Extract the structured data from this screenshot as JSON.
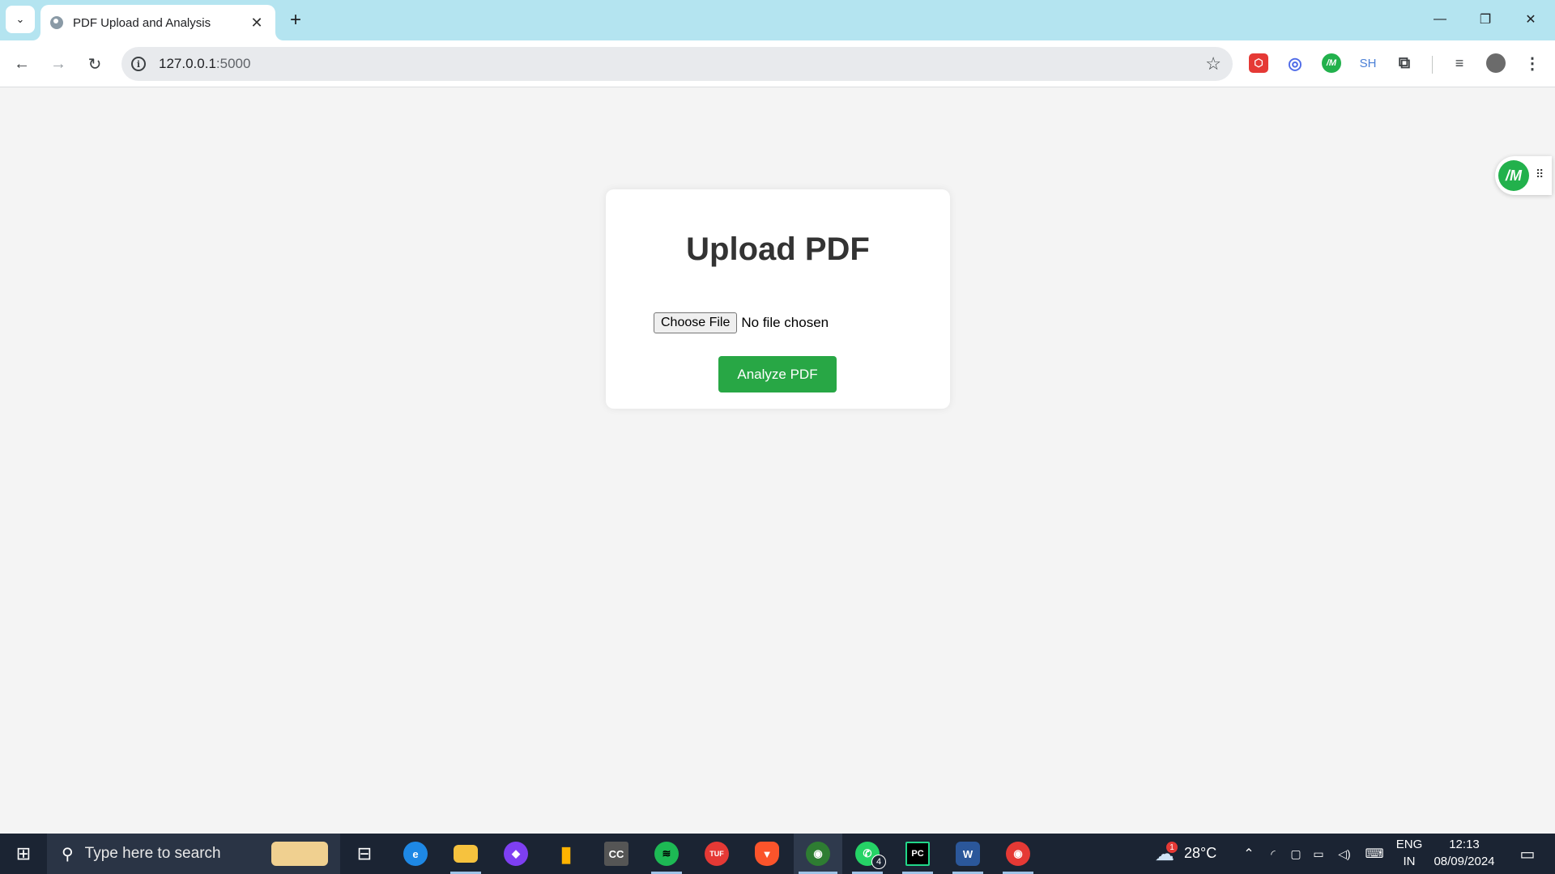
{
  "browser": {
    "tab_title": "PDF Upload and Analysis",
    "url_host": "127.0.0.1",
    "url_port": ":5000",
    "new_tab_symbol": "+",
    "extensions": [
      {
        "icon": "cube-extension-icon",
        "text": "⬡",
        "color": "#e53935"
      },
      {
        "icon": "ring-extension-icon",
        "text": "◎",
        "color": "#4f6be8"
      },
      {
        "icon": "im-extension-icon",
        "text": "/M",
        "color": "#22b14c"
      },
      {
        "icon": "sh-extension-icon",
        "text": "SH",
        "color": "#4a7fd6"
      }
    ]
  },
  "page": {
    "heading": "Upload PDF",
    "choose_file_label": "Choose File",
    "file_status": "No file chosen",
    "analyze_button_label": "Analyze PDF",
    "side_widget_logo": "/M"
  },
  "taskbar": {
    "search_placeholder": "Type here to search",
    "apps": [
      {
        "name": "widgets-app",
        "label": "",
        "color": "#f0d090"
      },
      {
        "name": "task-view",
        "label": "⊟",
        "color": "transparent"
      },
      {
        "name": "edge-browser",
        "label": "e",
        "color": "#1e88e5"
      },
      {
        "name": "file-explorer",
        "label": "▬",
        "color": "#f6c23e"
      },
      {
        "name": "purple-app",
        "label": "◆",
        "color": "#7e3ff2"
      },
      {
        "name": "chart-app",
        "label": "▮",
        "color": "#ffb300"
      },
      {
        "name": "cc-app",
        "label": "CC",
        "color": "#555555"
      },
      {
        "name": "spotify-app",
        "label": "≋",
        "color": "#1db954"
      },
      {
        "name": "tuf-app",
        "label": "TUF",
        "color": "#e53935"
      },
      {
        "name": "brave-browser",
        "label": "▼",
        "color": "#fb542b"
      },
      {
        "name": "chrome-browser",
        "label": "◉",
        "color": "#2e7d32"
      },
      {
        "name": "whatsapp-app",
        "label": "✆",
        "color": "#25d366"
      },
      {
        "name": "pycharm-app",
        "label": "PC",
        "color": "#000000"
      },
      {
        "name": "word-app",
        "label": "W",
        "color": "#2b579a"
      },
      {
        "name": "chrome-profile-app",
        "label": "◉",
        "color": "#e53935"
      }
    ],
    "whatsapp_badge": "4",
    "weather_badge": "1",
    "temperature": "28°C",
    "language_top": "ENG",
    "language_bottom": "IN",
    "time": "12:13",
    "date": "08/09/2024"
  }
}
